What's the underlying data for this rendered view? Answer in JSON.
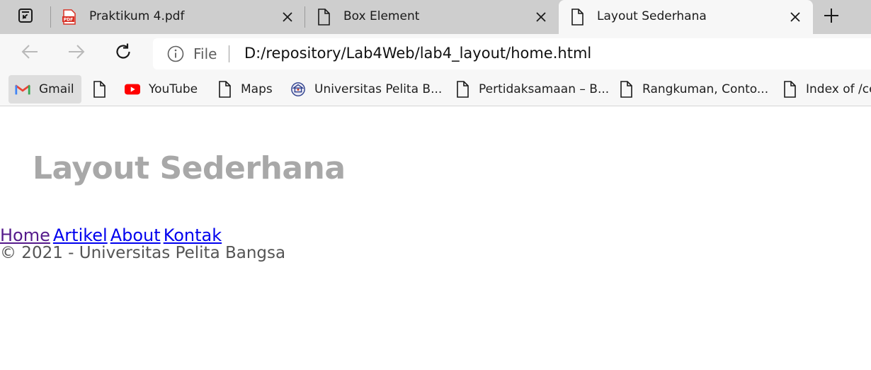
{
  "browser": {
    "tabs": [
      {
        "title": "Praktikum 4.pdf",
        "icon": "pdf-icon",
        "active": false
      },
      {
        "title": "Box Element",
        "icon": "page-icon",
        "active": false
      },
      {
        "title": "Layout Sederhana",
        "icon": "page-icon",
        "active": true
      }
    ],
    "address": {
      "scheme": "File",
      "url": "D:/repository/Lab4Web/lab4_layout/home.html"
    },
    "bookmarks": [
      {
        "label": "Gmail",
        "icon": "gmail-icon"
      },
      {
        "label": "",
        "icon": "page-icon"
      },
      {
        "label": "YouTube",
        "icon": "youtube-icon"
      },
      {
        "label": "Maps",
        "icon": "page-icon"
      },
      {
        "label": "Universitas Pelita B...",
        "icon": "university-icon"
      },
      {
        "label": "Pertidaksamaan – B...",
        "icon": "page-icon"
      },
      {
        "label": "Rangkuman, Conto...",
        "icon": "page-icon"
      },
      {
        "label": "Index of /ce",
        "icon": "page-icon"
      }
    ]
  },
  "page": {
    "header_title": "Layout Sederhana",
    "nav": [
      "Home",
      "Artikel",
      "About",
      "Kontak"
    ],
    "footer": "© 2021 - Universitas Pelita Bangsa"
  },
  "colors": {
    "tab_strip_bg": "#cecece",
    "toolbar_bg": "#f7f7f7",
    "header_text": "#a8a8a8",
    "link": "#0000ee",
    "visited_link": "#551a8b",
    "footer_text": "#555555"
  }
}
